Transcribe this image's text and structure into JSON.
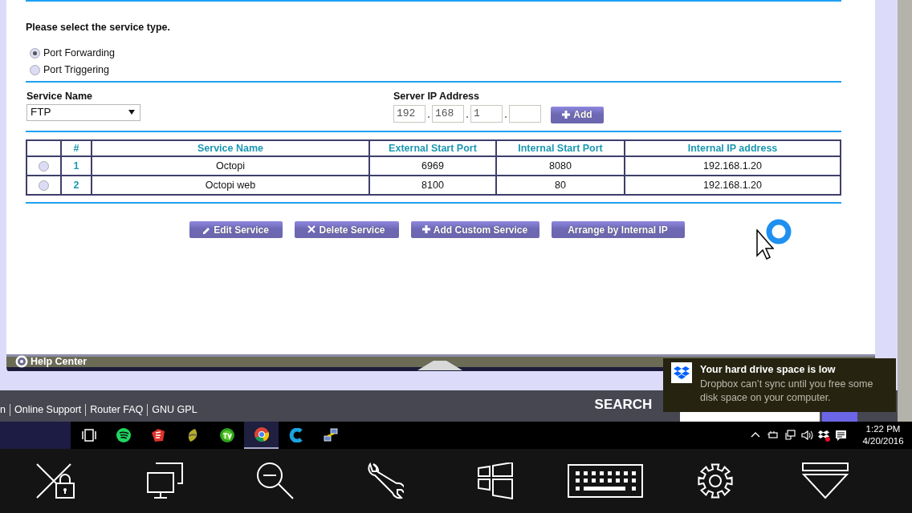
{
  "service_type": {
    "heading": "Please select the service type.",
    "options": [
      {
        "label": "Port Forwarding",
        "selected": true
      },
      {
        "label": "Port Triggering",
        "selected": false
      }
    ]
  },
  "service_name": {
    "label": "Service Name",
    "value": "FTP"
  },
  "server_ip": {
    "label": "Server IP Address",
    "octets": [
      "192",
      "168",
      "1"
    ],
    "button": "Add"
  },
  "table": {
    "columns": [
      "#",
      "Service Name",
      "External Start Port",
      "Internal Start Port",
      "Internal IP address"
    ],
    "rows": [
      {
        "selected": false,
        "cells": [
          "1",
          "Octopi",
          "6969",
          "8080",
          "192.168.1.20"
        ]
      },
      {
        "selected": false,
        "cells": [
          "2",
          "Octopi web",
          "8100",
          "80",
          "192.168.1.20"
        ]
      }
    ]
  },
  "actions": [
    {
      "label": "Edit Service",
      "kind": "pencil"
    },
    {
      "label": "Delete Service",
      "kind": "cross"
    },
    {
      "label": "Add Custom Service",
      "kind": "plus"
    },
    {
      "label": "Arrange by Internal IP",
      "kind": "none"
    }
  ],
  "help_center": "Help Center",
  "footer_links": [
    "n",
    "Online Support",
    "Router FAQ",
    "GNU GPL"
  ],
  "search_label": "SEARCH",
  "taskbar": {
    "apps": [
      {
        "kind": "task-view",
        "selected": false
      },
      {
        "kind": "music",
        "selected": false
      },
      {
        "kind": "cube",
        "selected": false
      },
      {
        "kind": "leaf",
        "selected": false
      },
      {
        "kind": "tv",
        "selected": false
      },
      {
        "kind": "browser",
        "selected": true
      },
      {
        "kind": "letter-c",
        "selected": false
      },
      {
        "kind": "network",
        "selected": false
      }
    ],
    "tray": [
      {
        "kind": "chevron"
      },
      {
        "kind": "power"
      },
      {
        "kind": "network"
      },
      {
        "kind": "volume"
      },
      {
        "kind": "box-error"
      },
      {
        "kind": "message"
      }
    ],
    "time": "1:22 PM",
    "date": "4/20/2016"
  },
  "notification": {
    "title": "Your hard drive space is low",
    "body": "Dropbox can’t sync until you free some disk space on your computer."
  },
  "remote_toolbar": [
    {
      "kind": "lock-cross"
    },
    {
      "kind": "monitors"
    },
    {
      "kind": "zoom-out"
    },
    {
      "kind": "wrench"
    },
    {
      "kind": "windows"
    },
    {
      "kind": "keyboard"
    },
    {
      "kind": "gear"
    },
    {
      "kind": "dropdown"
    }
  ]
}
